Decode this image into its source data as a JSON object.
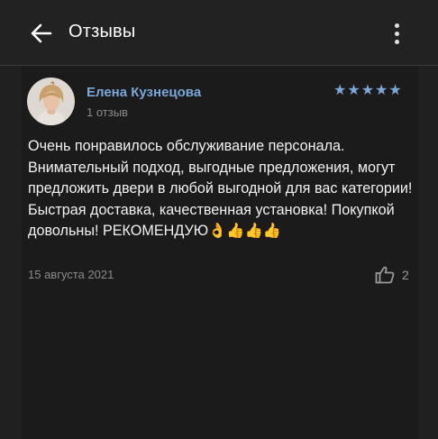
{
  "header": {
    "title": "Отзывы"
  },
  "review": {
    "author": "Елена Кузнецова",
    "review_count": "1 отзыв",
    "rating": 5,
    "text": "Очень понравилось обслуживание персонала. Внимательный подход, выгодные предложения, могут предложить двери в любой выгодной для вас категории! Быстрая доставка, качественная установка! Покупкой довольны! РЕКОМЕНДУЮ👌👍👍👍",
    "date": "15 августа 2021",
    "likes": "2"
  },
  "colors": {
    "accent": "#7ba7d9",
    "background": "#202020",
    "muted": "#8a8a8a"
  }
}
